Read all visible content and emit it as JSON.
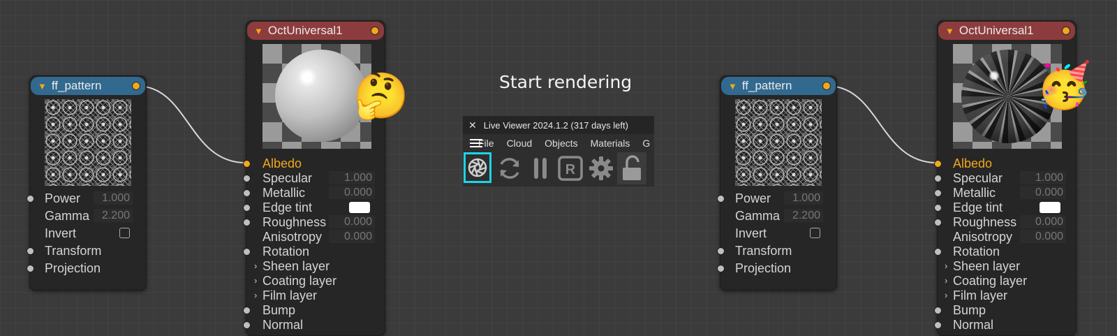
{
  "header": {
    "title": "Start rendering"
  },
  "viewer": {
    "window_title": "Live Viewer 2024.1.2 (317 days left)",
    "close_glyph": "✕",
    "menu": [
      "File",
      "Cloud",
      "Objects",
      "Materials",
      "G"
    ],
    "toolbar": [
      {
        "name": "start-render-icon",
        "highlighted": true
      },
      {
        "name": "restart-render-icon"
      },
      {
        "name": "pause-render-icon"
      },
      {
        "name": "region-render-icon"
      },
      {
        "name": "settings-gear-icon"
      },
      {
        "name": "unlock-icon"
      }
    ],
    "highlight_color": "#1ad5e8"
  },
  "nodes": {
    "pattern_left": {
      "title": "ff_pattern",
      "params": [
        {
          "label": "Power",
          "value": "1.000"
        },
        {
          "label": "Gamma",
          "value": "2.200"
        },
        {
          "label": "Invert"
        },
        {
          "label": "Transform"
        },
        {
          "label": "Projection"
        }
      ]
    },
    "universal_left": {
      "title": "OctUniversal1",
      "reaction_emoji": "🤔",
      "params": [
        {
          "label": "Albedo"
        },
        {
          "label": "Specular",
          "value": "1.000"
        },
        {
          "label": "Metallic",
          "value": "0.000"
        },
        {
          "label": "Edge tint"
        },
        {
          "label": "Roughness",
          "value": "0.000"
        },
        {
          "label": "Anisotropy",
          "value": "0.000"
        },
        {
          "label": "Rotation"
        },
        {
          "label": "Sheen layer"
        },
        {
          "label": "Coating layer"
        },
        {
          "label": "Film layer"
        },
        {
          "label": "Bump"
        },
        {
          "label": "Normal"
        }
      ]
    },
    "pattern_right": {
      "title": "ff_pattern",
      "params": [
        {
          "label": "Power",
          "value": "1.000"
        },
        {
          "label": "Gamma",
          "value": "2.200"
        },
        {
          "label": "Invert"
        },
        {
          "label": "Transform"
        },
        {
          "label": "Projection"
        }
      ]
    },
    "universal_right": {
      "title": "OctUniversal1",
      "reaction_emoji": "🥳",
      "params": [
        {
          "label": "Albedo"
        },
        {
          "label": "Specular",
          "value": "1.000"
        },
        {
          "label": "Metallic",
          "value": "0.000"
        },
        {
          "label": "Edge tint"
        },
        {
          "label": "Roughness",
          "value": "0.000"
        },
        {
          "label": "Anisotropy",
          "value": "0.000"
        },
        {
          "label": "Rotation"
        },
        {
          "label": "Sheen layer"
        },
        {
          "label": "Coating layer"
        },
        {
          "label": "Film layer"
        },
        {
          "label": "Bump"
        },
        {
          "label": "Normal"
        }
      ]
    }
  },
  "colors": {
    "canvas_bg": "#3b3b3b",
    "pattern_header": "#32698f",
    "material_header": "#8c3c3c",
    "pin_accent": "#f0a81c",
    "wire": "#d8d8d8"
  }
}
